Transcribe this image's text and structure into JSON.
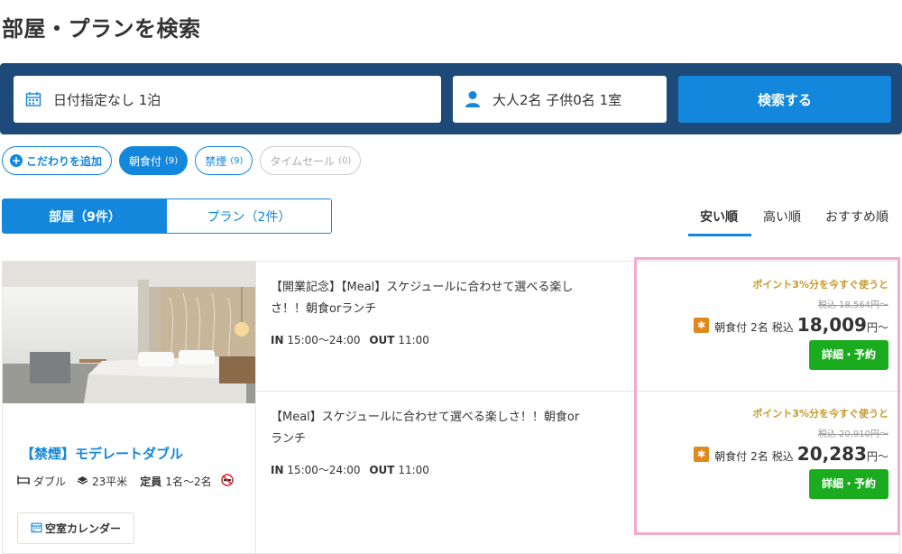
{
  "page": {
    "title": "部屋・プランを検索"
  },
  "search": {
    "date_value": "日付指定なし 1泊",
    "guests_value": "大人2名 子供0名 1室",
    "button_label": "検索する"
  },
  "filters": [
    {
      "label": "こだわりを追加",
      "count": ""
    },
    {
      "label": "朝食付",
      "count": "(9)"
    },
    {
      "label": "禁煙",
      "count": "(9)"
    },
    {
      "label": "タイムセール",
      "count": "(0)"
    }
  ],
  "tabs": {
    "rooms": "部屋（9件）",
    "plans": "プラン（2件）"
  },
  "sort": {
    "cheap": "安い順",
    "expensive": "高い順",
    "recommended": "おすすめ順"
  },
  "room": {
    "name": "【禁煙】モデレートダブル",
    "bed": "ダブル",
    "size": "23平米",
    "capacity_label": "定員",
    "capacity": "1名～2名",
    "calendar_button": "空室カレンダー"
  },
  "plans": [
    {
      "title": "【開業記念】【Meal】スケジュールに合わせて選べる楽しさ！！朝食orランチ",
      "checkin_label": "IN",
      "checkin": "15:00～24:00",
      "checkout_label": "OUT",
      "checkout": "11:00",
      "point_msg": "ポイント3%分を今すぐ使うと",
      "original_price": "税込 18,564円～",
      "meal": "朝食付",
      "persons": "2名",
      "tax_label": "税込",
      "price": "18,009",
      "price_suffix": "円～",
      "button": "詳細・予約"
    },
    {
      "title": "【Meal】スケジュールに合わせて選べる楽しさ！！朝食orランチ",
      "checkin_label": "IN",
      "checkin": "15:00～24:00",
      "checkout_label": "OUT",
      "checkout": "11:00",
      "point_msg": "ポイント3%分を今すぐ使うと",
      "original_price": "税込 20,910円～",
      "meal": "朝食付",
      "persons": "2名",
      "tax_label": "税込",
      "price": "20,283",
      "price_suffix": "円～",
      "button": "詳細・予約"
    }
  ],
  "colors": {
    "header_bg": "#1d4a78",
    "accent": "#1287dc",
    "reserve": "#1aab1f",
    "highlight": "#f6a9c9"
  }
}
